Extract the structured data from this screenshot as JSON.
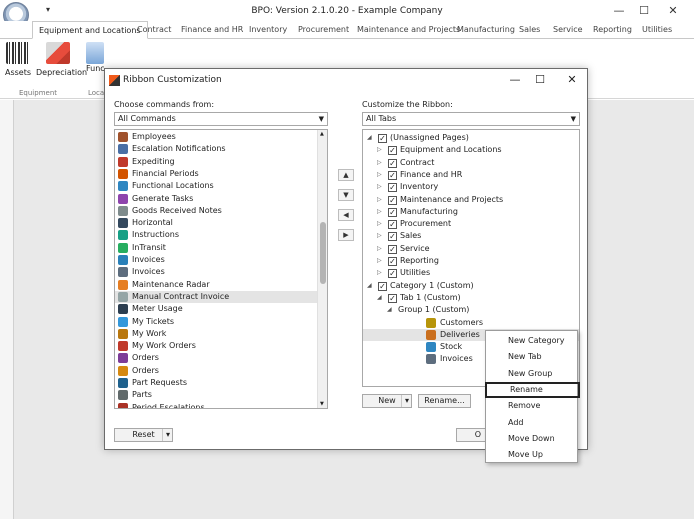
{
  "app": {
    "title": "BPO: Version 2.1.0.20 - Example Company",
    "qat": "▾",
    "min": "—",
    "max": "☐",
    "close": "✕"
  },
  "menu_tabs": [
    "Equipment and Locations",
    "Contract",
    "Finance and HR",
    "Inventory",
    "Procurement",
    "Maintenance and Projects",
    "Manufacturing",
    "Sales",
    "Service",
    "Reporting",
    "Utilities"
  ],
  "ribbon": {
    "buttons": [
      "Assets",
      "Depreciation",
      "Functional Loc"
    ],
    "group_label": "Equipment",
    "group_label2": "Loca"
  },
  "dialog": {
    "title": "Ribbon Customization",
    "left_label": "Choose commands from:",
    "left_combo": "All Commands",
    "right_label": "Customize the Ribbon:",
    "right_combo": "All Tabs",
    "commands": [
      {
        "label": "Employees",
        "color": "#a0522d"
      },
      {
        "label": "Escalation Notifications",
        "color": "#4a6fa5"
      },
      {
        "label": "Expediting",
        "color": "#c0392b"
      },
      {
        "label": "Financial Periods",
        "color": "#d35400"
      },
      {
        "label": "Functional Locations",
        "color": "#2e86c1"
      },
      {
        "label": "Generate Tasks",
        "color": "#8e44ad"
      },
      {
        "label": "Goods Received Notes",
        "color": "#7f8c8d"
      },
      {
        "label": "Horizontal",
        "color": "#34495e"
      },
      {
        "label": "Instructions",
        "color": "#16a085"
      },
      {
        "label": "InTransit",
        "color": "#27ae60"
      },
      {
        "label": "Invoices",
        "color": "#2980b9"
      },
      {
        "label": "Invoices",
        "color": "#5d6d7e"
      },
      {
        "label": "Maintenance Radar",
        "color": "#e67e22"
      },
      {
        "label": "Manual Contract Invoice",
        "color": "#95a5a6"
      },
      {
        "label": "Meter Usage",
        "color": "#2c3e50"
      },
      {
        "label": "My Tickets",
        "color": "#3498db"
      },
      {
        "label": "My Work",
        "color": "#b9770e"
      },
      {
        "label": "My Work Orders",
        "color": "#c0392b"
      },
      {
        "label": "Orders",
        "color": "#7d3c98"
      },
      {
        "label": "Orders",
        "color": "#d68910"
      },
      {
        "label": "Part Requests",
        "color": "#1f618d"
      },
      {
        "label": "Parts",
        "color": "#616a6b"
      },
      {
        "label": "Period Escalations",
        "color": "#a93226"
      }
    ],
    "selected_command_index": 13,
    "move_buttons": [
      "▲",
      "▼",
      "◀",
      "▶"
    ],
    "tree": [
      {
        "label": "(Unassigned Pages)",
        "level": 0,
        "expander": "◢",
        "checked": true
      },
      {
        "label": "Equipment and Locations",
        "level": 1,
        "expander": "▷",
        "checked": true
      },
      {
        "label": "Contract",
        "level": 1,
        "expander": "▷",
        "checked": true
      },
      {
        "label": "Finance and HR",
        "level": 1,
        "expander": "▷",
        "checked": true
      },
      {
        "label": "Inventory",
        "level": 1,
        "expander": "▷",
        "checked": true
      },
      {
        "label": "Maintenance and Projects",
        "level": 1,
        "expander": "▷",
        "checked": true
      },
      {
        "label": "Manufacturing",
        "level": 1,
        "expander": "▷",
        "checked": true
      },
      {
        "label": "Procurement",
        "level": 1,
        "expander": "▷",
        "checked": true
      },
      {
        "label": "Sales",
        "level": 1,
        "expander": "▷",
        "checked": true
      },
      {
        "label": "Service",
        "level": 1,
        "expander": "▷",
        "checked": true
      },
      {
        "label": "Reporting",
        "level": 1,
        "expander": "▷",
        "checked": true
      },
      {
        "label": "Utilities",
        "level": 1,
        "expander": "▷",
        "checked": true
      },
      {
        "label": "Category 1 (Custom)",
        "level": 0,
        "expander": "◢",
        "checked": true
      },
      {
        "label": "Tab 1 (Custom)",
        "level": 1,
        "expander": "◢",
        "checked": true
      },
      {
        "label": "Group 1 (Custom)",
        "level": 2,
        "expander": "◢",
        "checked": false
      },
      {
        "label": "Customers",
        "level": 3,
        "expander": "",
        "checked": false,
        "icon": "#b7950b"
      },
      {
        "label": "Deliveries",
        "level": 3,
        "expander": "",
        "checked": false,
        "icon": "#ca6f1e"
      },
      {
        "label": "Stock",
        "level": 3,
        "expander": "",
        "checked": false,
        "icon": "#2e86c1"
      },
      {
        "label": "Invoices",
        "level": 3,
        "expander": "",
        "checked": false,
        "icon": "#5d6d7e"
      }
    ],
    "selected_tree_index": 16,
    "check_mark": "✓",
    "new_button": "New",
    "new_arrow": "▾",
    "rename_button": "Rename...",
    "reset_button": "Reset",
    "reset_arrow": "▾",
    "ok_fragment": "O",
    "min": "—",
    "max": "☐",
    "close": "✕"
  },
  "context_menu": {
    "items": [
      "New Category",
      "New Tab",
      "New Group",
      "Rename",
      "Remove",
      "Add",
      "Move Down",
      "Move Up"
    ],
    "highlighted_index": 3
  }
}
